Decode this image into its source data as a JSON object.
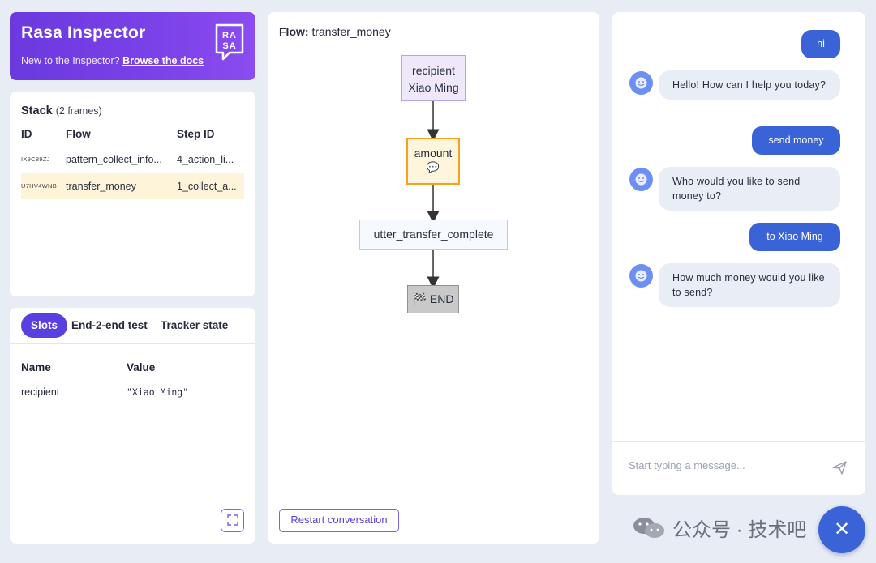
{
  "header": {
    "title": "Rasa Inspector",
    "subtitle": "New to the Inspector?",
    "docs_link": "Browse the docs",
    "logo_text": "RASA"
  },
  "stack": {
    "title": "Stack",
    "frames": "(2 frames)",
    "columns": [
      "ID",
      "Flow",
      "Step ID"
    ],
    "rows": [
      {
        "id": "IX9C89ZJ",
        "flow": "pattern_collect_info...",
        "step": "4_action_li..."
      },
      {
        "id": "U7HV4WNB",
        "flow": "transfer_money",
        "step": "1_collect_a..."
      }
    ]
  },
  "slots": {
    "tabs": [
      "Slots",
      "End-2-end test",
      "Tracker state"
    ],
    "columns": [
      "Name",
      "Value"
    ],
    "rows": [
      {
        "name": "recipient",
        "value": "\"Xiao Ming\""
      }
    ],
    "expand_icon": "expand-icon"
  },
  "flow": {
    "label": "Flow:",
    "name": "transfer_money",
    "nodes": {
      "recipient_line1": "recipient",
      "recipient_line2": "Xiao Ming",
      "amount": "amount",
      "amount_icon": "💬",
      "utter": "utter_transfer_complete",
      "end": "🏁 END"
    },
    "restart": "Restart conversation"
  },
  "chat": {
    "messages": [
      {
        "sender": "user",
        "text": "hi"
      },
      {
        "sender": "bot",
        "text": "Hello! How can I help you today?"
      },
      {
        "sender": "user",
        "text": "send money"
      },
      {
        "sender": "bot",
        "text": "Who would you like to send money to?"
      },
      {
        "sender": "user",
        "text": "to Xiao Ming"
      },
      {
        "sender": "bot",
        "text": "How much money would you like to send?"
      }
    ],
    "input_placeholder": "Start typing a message...",
    "send_icon": "send-icon"
  },
  "watermark": "公众号 · 技术吧",
  "fab_icon": "close-icon",
  "fab_glyph": "✕",
  "colors": {
    "accent": "#5a3fe0",
    "user_bubble": "#3b63d8",
    "bot_bubble": "#e8edf6",
    "active_row": "#fdf4d9",
    "amount_border": "#f5a21f"
  }
}
